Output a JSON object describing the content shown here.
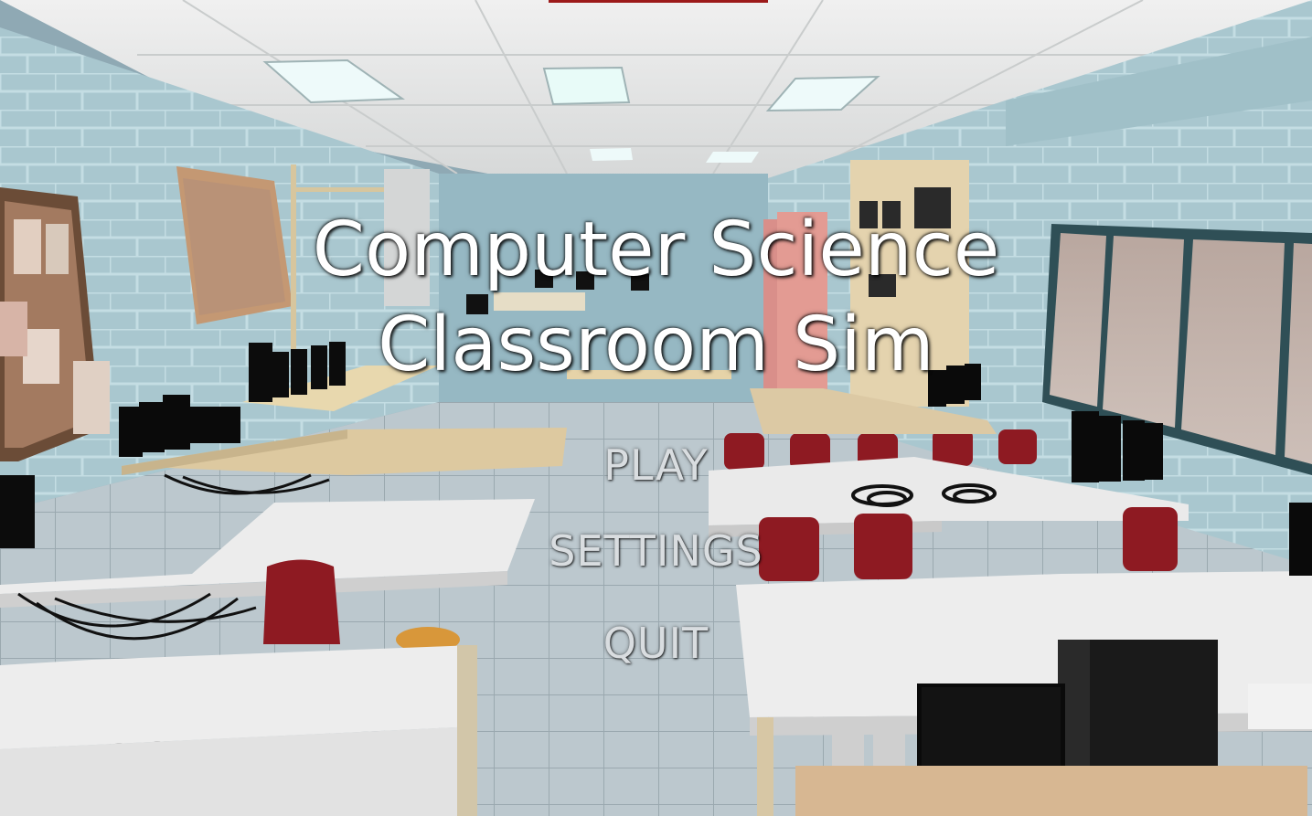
{
  "game": {
    "title_line1": "Computer Science",
    "title_line2": "Classroom Sim"
  },
  "menu": {
    "play_label": "PLAY",
    "settings_label": "SETTINGS",
    "quit_label": "QUIT"
  },
  "colors": {
    "title_text": "#ffffff",
    "menu_text": "#d9dde0",
    "wall": "#a9c8cf",
    "floor": "#c9d3d8",
    "ceiling": "#e9eaea",
    "desk": "#ebebea",
    "chair": "#8e1a22",
    "monitor": "#111111",
    "top_accent": "#9c1a1a"
  }
}
